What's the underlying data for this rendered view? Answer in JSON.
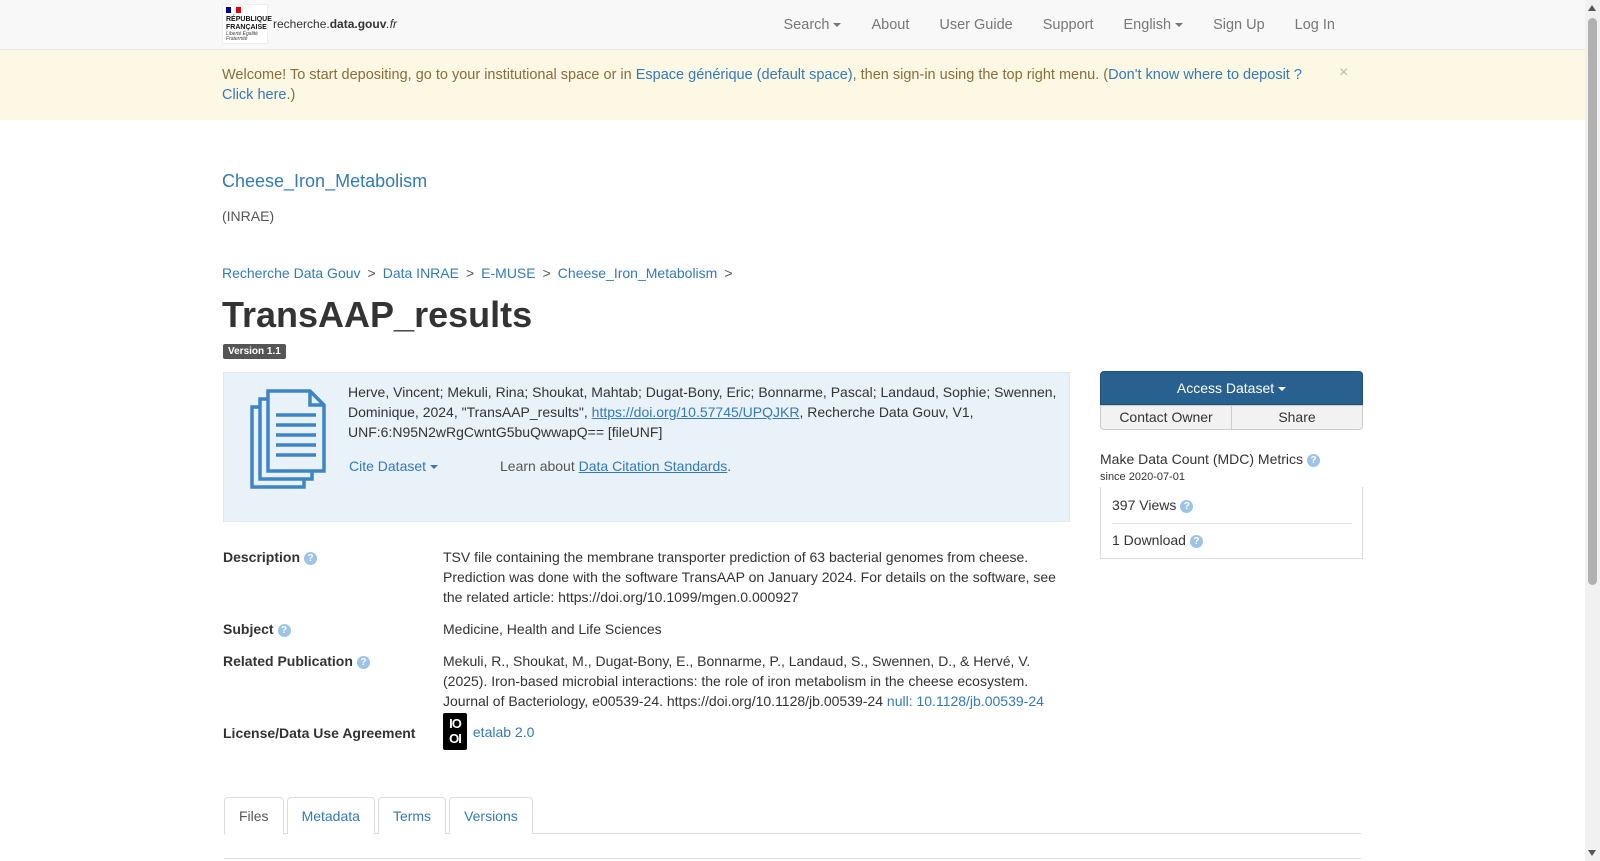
{
  "navbar": {
    "logo": {
      "line1": "RÉPUBLIQUE",
      "line2": "FRANÇAISE",
      "motto": "Liberté Égalité Fraternité",
      "site_prefix": "recherche.",
      "site_bold": "data.gouv",
      "site_suffix": ".fr"
    },
    "items": {
      "search": "Search",
      "about": "About",
      "user_guide": "User Guide",
      "support": "Support",
      "language": "English",
      "sign_up": "Sign Up",
      "log_in": "Log In"
    }
  },
  "alert": {
    "text1": "Welcome! To start depositing, go to your institutional space or in ",
    "link1": "Espace générique (default space)",
    "text2": ", then sign-in using the top right menu. (",
    "link2": "Don't know where to deposit ? Click here",
    "text3": ".)",
    "close": "×"
  },
  "dataverse": {
    "title": "Cheese_Iron_Metabolism",
    "affiliation": "(INRAE)"
  },
  "breadcrumb": {
    "items": [
      "Recherche Data Gouv",
      "Data INRAE",
      "E-MUSE",
      "Cheese_Iron_Metabolism"
    ],
    "separator": ">"
  },
  "dataset": {
    "title": "TransAAP_results",
    "version": "Version 1.1"
  },
  "citation": {
    "text_before": "Herve, Vincent; Mekuli, Rina; Shoukat, Mahtab; Dugat-Bony, Eric; Bonnarme, Pascal; Landaud, Sophie; Swennen, Dominique, 2024, \"TransAAP_results\", ",
    "doi_link": "https://doi.org/10.57745/UPQJKR",
    "text_after": ", Recherche Data Gouv, V1, UNF:6:N95N2wRgCwntG5buQwwapQ== [fileUNF]",
    "cite_button": "Cite Dataset",
    "learn_text": "Learn about ",
    "learn_link": "Data Citation Standards",
    "learn_end": "."
  },
  "actions": {
    "access_dataset": "Access Dataset",
    "contact_owner": "Contact Owner",
    "share": "Share"
  },
  "metrics": {
    "title": "Make Data Count (MDC) Metrics",
    "since": "since 2020-07-01",
    "views": "397 Views",
    "downloads": "1 Download",
    "help": "?"
  },
  "metadata": {
    "description_label": "Description",
    "description_value": "TSV file containing the membrane transporter prediction of 63 bacterial genomes from cheese. Prediction was done with the software TransAAP on January 2024. For details on the software, see the related article: https://doi.org/10.1099/mgen.0.000927",
    "subject_label": "Subject",
    "subject_value": "Medicine, Health and Life Sciences",
    "publication_label": "Related Publication",
    "publication_value": "Mekuli, R., Shoukat, M., Dugat-Bony, E., Bonnarme, P., Landaud, S., Swennen, D., & Hervé, V. (2025). Iron-based microbial interactions: the role of iron metabolism in the cheese ecosystem. Journal of Bacteriology, e00539-24. https://doi.org/10.1128/jb.00539-24 ",
    "publication_link": "null: 10.1128/jb.00539-24",
    "license_label": "License/Data Use Agreement",
    "license_icon_top": "IO",
    "license_icon_bottom": "OI",
    "license_value": "etalab 2.0"
  },
  "tabs": {
    "files": "Files",
    "metadata": "Metadata",
    "terms": "Terms",
    "versions": "Versions"
  },
  "colors": {
    "link": "#337ab7",
    "primary_button": "#286090",
    "alert_bg": "#fcf8e3",
    "alert_text": "#8a6d3b",
    "citation_bg": "#e9f1f9"
  }
}
